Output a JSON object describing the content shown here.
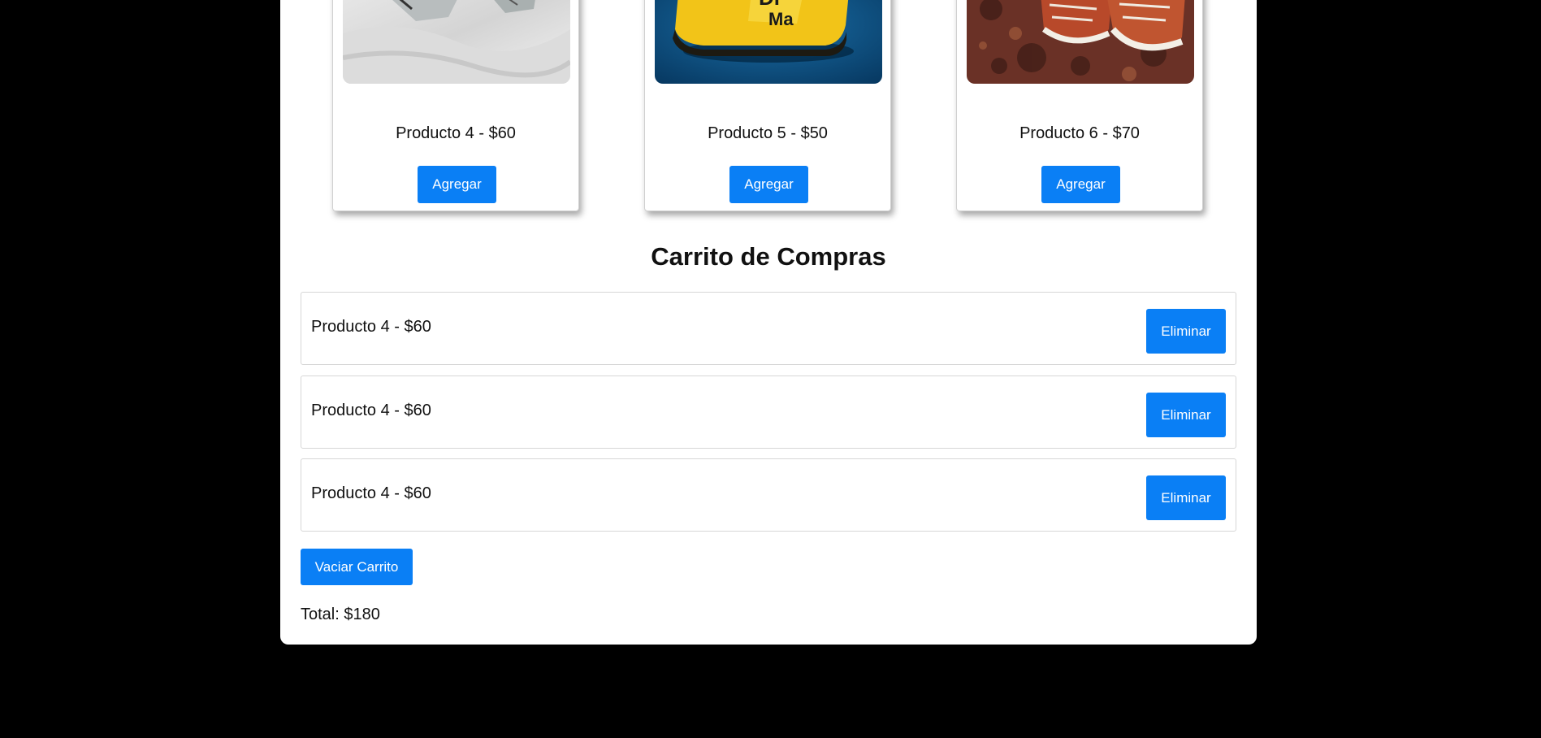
{
  "products": [
    {
      "name": "Producto 4 - $60",
      "button": "Agregar",
      "image": "sneaker-photo"
    },
    {
      "name": "Producto 5 - $50",
      "button": "Agregar",
      "image": "yellow-boot-photo"
    },
    {
      "name": "Producto 6 - $70",
      "button": "Agregar",
      "image": "converse-sneakers-photo"
    }
  ],
  "cart": {
    "title": "Carrito de Compras",
    "items": [
      {
        "label": "Producto 4 - $60",
        "remove": "Eliminar"
      },
      {
        "label": "Producto 4 - $60",
        "remove": "Eliminar"
      },
      {
        "label": "Producto 4 - $60",
        "remove": "Eliminar"
      }
    ],
    "clear_label": "Vaciar Carrito",
    "total": "Total: $180"
  },
  "colors": {
    "accent": "#0a7ff5",
    "background": "#000000",
    "panel": "#ffffff"
  }
}
